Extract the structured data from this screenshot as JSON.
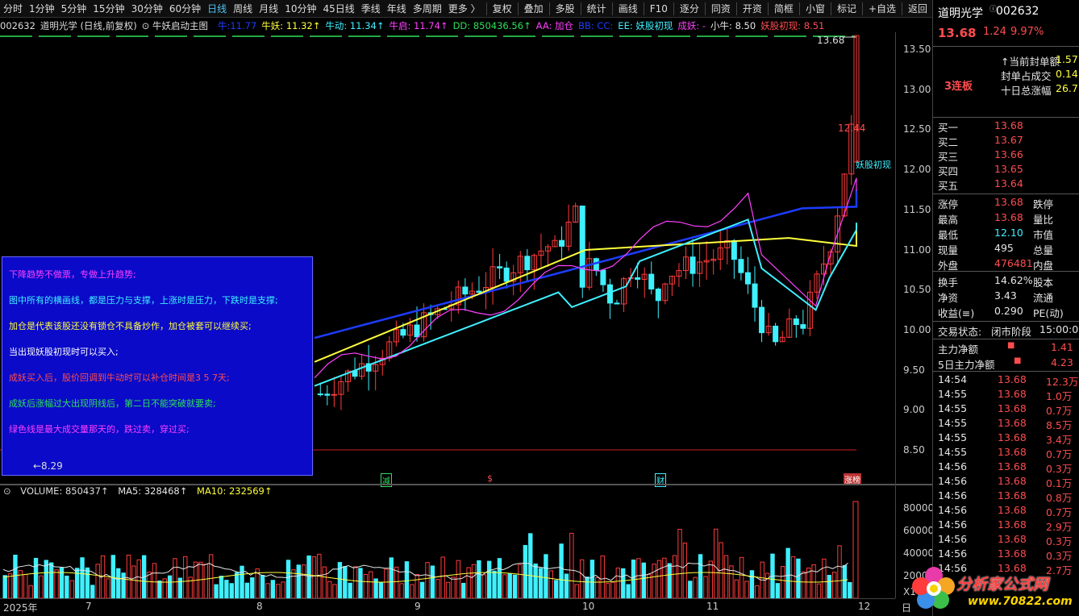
{
  "toolbar": {
    "period_items": [
      "分时",
      "1分钟",
      "5分钟",
      "15分钟",
      "30分钟",
      "60分钟",
      "日线",
      "周线",
      "月线",
      "10分钟",
      "45日线",
      "季线",
      "年线",
      "多周期",
      "更多 〉"
    ],
    "active_period": "日线",
    "tool_items": [
      "复权",
      "叠加",
      "多股",
      "统计",
      "画线",
      "F10",
      "逐分",
      "同资",
      "开资",
      "简框",
      "小窗",
      "标记",
      "+自选",
      "返回"
    ]
  },
  "indicator_line": {
    "code": "002632",
    "name": "道明光学 (日线,前复权)",
    "formula": "牛妖启动主图",
    "items": [
      {
        "text": "牛:11.77",
        "color": "#1e3cff"
      },
      {
        "text": "牛妖: 11.32↑",
        "color": "#ffff3d"
      },
      {
        "text": "牛动: 11.34↑",
        "color": "#3ff0ff"
      },
      {
        "text": "牛启: 11.74↑",
        "color": "#ff40ff"
      },
      {
        "text": "DD: 850436.56↑",
        "color": "#2ee05a"
      },
      {
        "text": "AA: 加仓",
        "color": "#ff40ff"
      },
      {
        "text": "BB: CC:",
        "color": "#1e3cff"
      },
      {
        "text": "EE: 妖股初现",
        "color": "#3ff0ff"
      },
      {
        "text": "成妖: -",
        "color": "#ff40ff"
      },
      {
        "text": "小牛: 8.50",
        "color": "#e6e6e6"
      },
      {
        "text": "妖股初现: 8.51",
        "color": "#ff4d4f"
      }
    ]
  },
  "price_axis": [
    "13.50",
    "13.00",
    "12.50",
    "12.00",
    "11.50",
    "11.00",
    "10.50",
    "10.00",
    "9.50",
    "9.00",
    "8.50"
  ],
  "volume_axis": [
    "80000",
    "60000",
    "40000",
    "20000",
    "X10"
  ],
  "date_axis": [
    {
      "label": "2025年"
    },
    {
      "label": "7"
    },
    {
      "label": "8"
    },
    {
      "label": "9"
    },
    {
      "label": "10"
    },
    {
      "label": "11"
    },
    {
      "label": "12"
    },
    {
      "label": "日"
    }
  ],
  "chart_labels": {
    "high_mark": "13.68",
    "mid_mark": "12.44",
    "low_mark": "←8.29",
    "yao_tag": "妖股初现",
    "markers": [
      "减",
      "$",
      "财",
      "涨榜"
    ]
  },
  "volume_label": {
    "volume": "VOLUME: 850437↑",
    "ma5": "MA5: 328468↑",
    "ma10": "MA10: 232569↑"
  },
  "notes": [
    {
      "text": "下降趋势不做票，专做上升趋势;",
      "color": "#ff40ff"
    },
    {
      "text": "图中所有的横画线，都是压力与支撑，上涨时是压力，下跌时是支撑;",
      "color": "#3ff0ff"
    },
    {
      "text": "加仓是代表该股还没有锁仓不具备炒作，加仓被套可以继续买;",
      "color": "#ffff3d"
    },
    {
      "text": "当出现妖股初现时可以买入;",
      "color": "#ffffff"
    },
    {
      "text": "成妖买入后，股价回调到牛动时可以补仓时间是3  5  7天;",
      "color": "#ff4d4f"
    },
    {
      "text": "成妖后涨幅过大出现阴线后，第二日不能突破就要卖;",
      "color": "#2ee05a"
    },
    {
      "text": "绿色线是最大成交量那天的，跌过卖，穿过买;",
      "color": "#ff40ff"
    }
  ],
  "right_panel": {
    "stock_name": "道明光学",
    "stock_code": "002632",
    "price": "13.68",
    "change": "1.24",
    "change_pct": "9.97%",
    "streak": "3连板",
    "seal": [
      {
        "label": "当前封单额",
        "value": "1.57"
      },
      {
        "label": "封单占成交",
        "value": "0.14"
      },
      {
        "label": "十日总涨幅",
        "value": "26.7"
      }
    ],
    "bids": [
      {
        "label": "买一",
        "price": "13.68"
      },
      {
        "label": "买二",
        "price": "13.67"
      },
      {
        "label": "买三",
        "price": "13.66"
      },
      {
        "label": "买四",
        "price": "13.65"
      },
      {
        "label": "买五",
        "price": "13.64"
      }
    ],
    "stats": [
      {
        "l1": "涨停",
        "v1": "13.68",
        "l2": "跌停",
        "c": "red"
      },
      {
        "l1": "最高",
        "v1": "13.68",
        "l2": "量比",
        "c": "red"
      },
      {
        "l1": "最低",
        "v1": "12.10",
        "l2": "市值",
        "c": "cyan"
      },
      {
        "l1": "现量",
        "v1": "495",
        "l2": "总量",
        "c": "white"
      },
      {
        "l1": "外盘",
        "v1": "476481",
        "l2": "内盘",
        "c": "red"
      }
    ],
    "stats2": [
      {
        "l1": "换手",
        "v1": "14.62%",
        "l2": "股本"
      },
      {
        "l1": "净资",
        "v1": "3.43",
        "l2": "流通"
      },
      {
        "l1": "收益(≡)",
        "v1": "0.290",
        "l2": "PE(动)"
      }
    ],
    "trade_status": {
      "label": "交易状态:",
      "value": "闭市阶段",
      "time": "15:00:0"
    },
    "flow": [
      {
        "label": "主力净额",
        "value": "1.41"
      },
      {
        "label": "5日主力净额",
        "value": "4.23"
      }
    ],
    "ticks": [
      {
        "t": "14:54",
        "p": "13.68",
        "v": "12.3万"
      },
      {
        "t": "14:55",
        "p": "13.68",
        "v": "1.0万"
      },
      {
        "t": "14:55",
        "p": "13.68",
        "v": "0.7万"
      },
      {
        "t": "14:55",
        "p": "13.68",
        "v": "8.5万"
      },
      {
        "t": "14:55",
        "p": "13.68",
        "v": "3.4万"
      },
      {
        "t": "14:55",
        "p": "13.68",
        "v": "0.7万"
      },
      {
        "t": "14:56",
        "p": "13.68",
        "v": "0.3万"
      },
      {
        "t": "14:56",
        "p": "13.68",
        "v": "0.1万"
      },
      {
        "t": "14:56",
        "p": "13.68",
        "v": "0.8万"
      },
      {
        "t": "14:56",
        "p": "13.68",
        "v": "0.7万"
      },
      {
        "t": "14:56",
        "p": "13.68",
        "v": "2.9万"
      },
      {
        "t": "14:56",
        "p": "13.68",
        "v": "0.3万"
      },
      {
        "t": "14:56",
        "p": "13.68",
        "v": "0.3万"
      },
      {
        "t": "14:56",
        "p": "13.68",
        "v": "2.7万"
      }
    ]
  },
  "watermark": {
    "title": "分析家公式网",
    "url": "www.70822.com"
  }
}
